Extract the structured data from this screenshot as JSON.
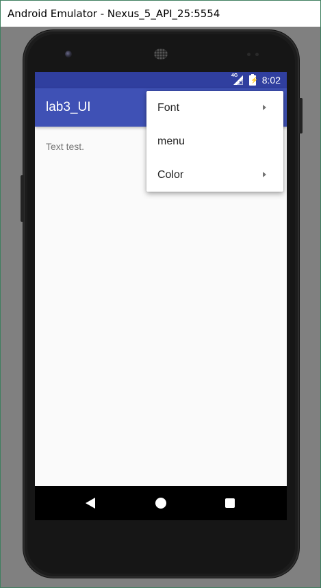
{
  "window": {
    "title": "Android Emulator - Nexus_5_API_25:5554"
  },
  "status_bar": {
    "network": "4G",
    "time": "8:02",
    "color": "#303f9f"
  },
  "app_bar": {
    "title": "lab3_UI",
    "color": "#3f51b5"
  },
  "content": {
    "text": "Text test."
  },
  "overflow_menu": {
    "items": [
      {
        "label": "Font",
        "has_submenu": true
      },
      {
        "label": "menu",
        "has_submenu": false
      },
      {
        "label": "Color",
        "has_submenu": true
      }
    ]
  },
  "navigation_bar": {
    "buttons": [
      "back-icon",
      "home-icon",
      "recents-icon"
    ]
  }
}
